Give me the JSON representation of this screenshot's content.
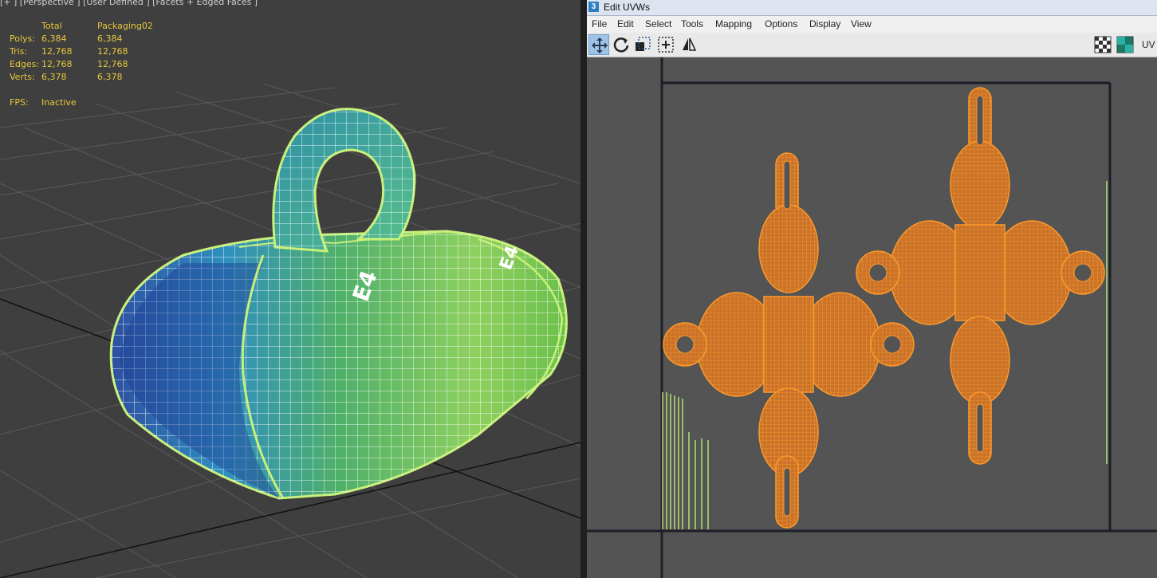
{
  "viewport": {
    "label": "[+ ] [Perspective ] [User Defined ] [Facets + Edged Faces ]",
    "stats": {
      "headers": [
        "",
        "Total",
        "Packaging02"
      ],
      "rows": [
        {
          "label": "Polys:",
          "total": "6,384",
          "object": "6,384"
        },
        {
          "label": "Tris:",
          "total": "12,768",
          "object": "12,768"
        },
        {
          "label": "Edges:",
          "total": "12,768",
          "object": "12,768"
        },
        {
          "label": "Verts:",
          "total": "6,378",
          "object": "6,378"
        }
      ],
      "fps_label": "FPS:",
      "fps_value": "Inactive"
    },
    "model_label": "E4"
  },
  "uv_editor": {
    "app_icon": "3",
    "title": "Edit UVWs",
    "menu": [
      "File",
      "Edit",
      "Select",
      "Tools",
      "Mapping",
      "Options",
      "Display",
      "View"
    ],
    "toolbar_icons": [
      "move-icon",
      "rotate-icon",
      "scale-icon",
      "freeform-icon",
      "mirror-icon",
      "checker-icon",
      "checker-texture-icon"
    ],
    "toolbar_trailing_label": "UV"
  },
  "colors": {
    "stats_text": "#e8c83a",
    "uv_wire": "#ff8a1a",
    "uv_fill": "#d4782a",
    "selected_edge": "#b4e070",
    "viewport_bg": "#3f3f3f",
    "uv_bg": "#545454"
  }
}
